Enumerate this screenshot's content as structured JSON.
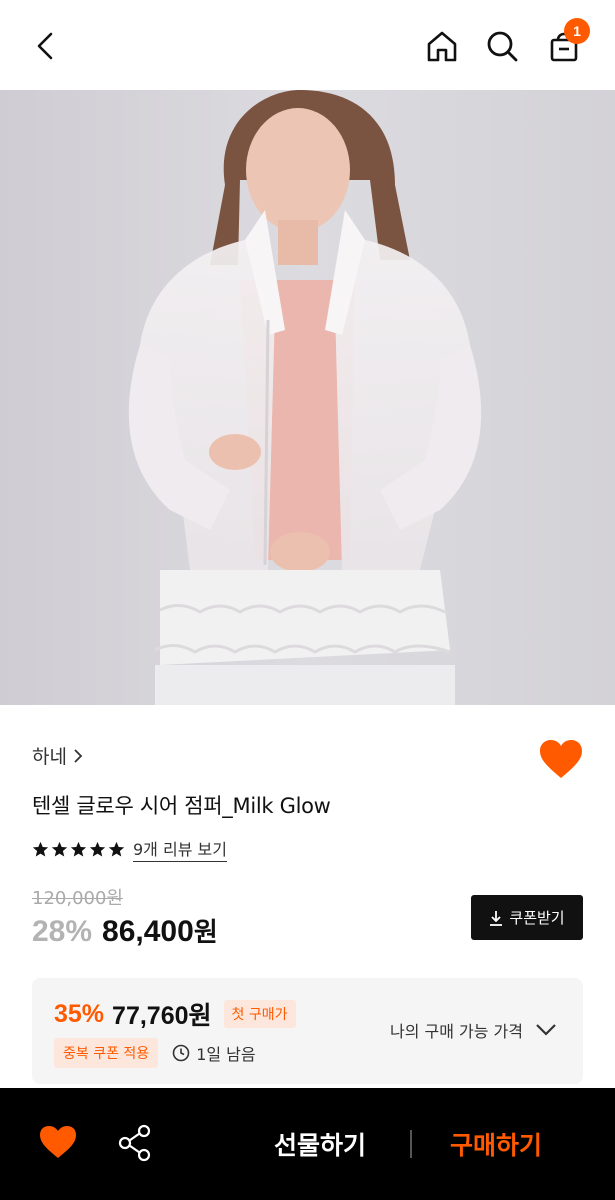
{
  "header": {
    "cart_count": "1"
  },
  "product": {
    "brand": "하네",
    "title": "텐셀 글로우 시어 점퍼_Milk Glow",
    "review_link": "9개 리뷰 보기",
    "rating": 5,
    "original_price": "120,000원",
    "discount_rate": "28%",
    "sale_price": "86,400",
    "sale_unit": "원",
    "coupon_button": "쿠폰받기"
  },
  "benefit": {
    "discount_rate": "35%",
    "price": "77,760원",
    "first_purchase_tag": "첫 구매가",
    "coupon_tag": "중복 쿠폰 적용",
    "time_left": "1일 남음",
    "my_price_label": "나의 구매 가능 가격"
  },
  "bottom_bar": {
    "gift_label": "선물하기",
    "buy_label": "구매하기"
  },
  "colors": {
    "accent": "#ff5a00",
    "dark": "#111111",
    "bottom_bar": "#000000"
  },
  "icons": [
    "back-arrow-icon",
    "home-icon",
    "search-icon",
    "cart-icon",
    "heart-icon",
    "share-icon",
    "download-icon",
    "clock-icon",
    "chevron-down-icon",
    "star-icon"
  ]
}
